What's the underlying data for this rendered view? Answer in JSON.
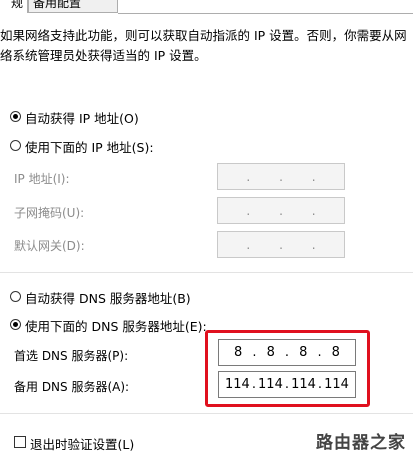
{
  "tabs": [
    {
      "label": "规",
      "active": true
    },
    {
      "label": "备用配置",
      "active": false
    }
  ],
  "description": {
    "line1": "如果网络支持此功能，则可以获取自动指派的 IP 设置。否则，你需要从网",
    "line2": "络系统管理员处获得适当的 IP 设置。"
  },
  "ip_section": {
    "auto_label": "自动获得 IP 地址(O)",
    "manual_label": "使用下面的 IP 地址(S):",
    "auto_selected": true,
    "fields": [
      {
        "label": "IP 地址(I):"
      },
      {
        "label": "子网掩码(U):"
      },
      {
        "label": "默认网关(D):"
      }
    ]
  },
  "dns_section": {
    "auto_label": "自动获得 DNS 服务器地址(B)",
    "manual_label": "使用下面的 DNS 服务器地址(E):",
    "manual_selected": true,
    "preferred": {
      "label": "首选 DNS 服务器(P):",
      "octets": [
        "8",
        "8",
        "8",
        "8"
      ]
    },
    "alternate": {
      "label": "备用 DNS 服务器(A):",
      "octets": [
        "114",
        "114",
        "114",
        "114"
      ]
    },
    "highlight_color": "#e0101e"
  },
  "validate": {
    "label": "退出时验证设置(L)",
    "checked": false
  },
  "watermark": "路由器之家"
}
